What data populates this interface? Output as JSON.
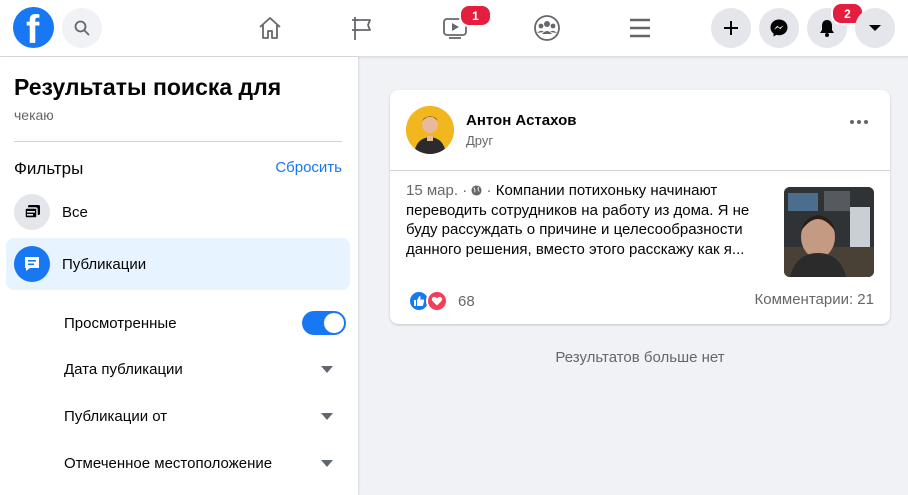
{
  "topbar": {
    "logo_letter": "f",
    "nav": [
      {
        "name": "home-icon"
      },
      {
        "name": "flag-icon"
      },
      {
        "name": "watch-icon",
        "badge": "1"
      },
      {
        "name": "groups-icon"
      },
      {
        "name": "menu-icon"
      }
    ],
    "actions": [
      {
        "name": "plus-icon"
      },
      {
        "name": "messenger-icon"
      },
      {
        "name": "bell-icon",
        "badge": "2"
      },
      {
        "name": "chevron-down-icon"
      }
    ]
  },
  "sidebar": {
    "title": "Результаты поиска для",
    "query": "чекаю",
    "filters_label": "Фильтры",
    "reset_label": "Сбросить",
    "items": [
      {
        "label": "Все",
        "icon": "all-results-icon",
        "active": false
      },
      {
        "label": "Публикации",
        "icon": "posts-icon",
        "active": true
      }
    ],
    "sub_filters": [
      {
        "label": "Просмотренные",
        "control": "toggle",
        "state": "on"
      },
      {
        "label": "Дата публикации",
        "control": "dropdown"
      },
      {
        "label": "Публикации от",
        "control": "dropdown"
      },
      {
        "label": "Отмеченное местоположение",
        "control": "dropdown"
      }
    ]
  },
  "post": {
    "author": "Антон Астахов",
    "relation": "Друг",
    "date": "15 мар.",
    "separator": "·",
    "text": "Компании потихоньку начинают переводить сотрудников на работу из дома. Я не буду рассуждать о причине и целесообразности данного решения, вместо этого расскажу как я...",
    "reaction_count": "68",
    "comments": "Комментарии: 21"
  },
  "footer_text": "Результатов больше нет",
  "colors": {
    "brand": "#1877f2",
    "badge": "#e41e3f",
    "active_bg": "#e7f3ff",
    "page_bg": "#f0f2f5"
  }
}
